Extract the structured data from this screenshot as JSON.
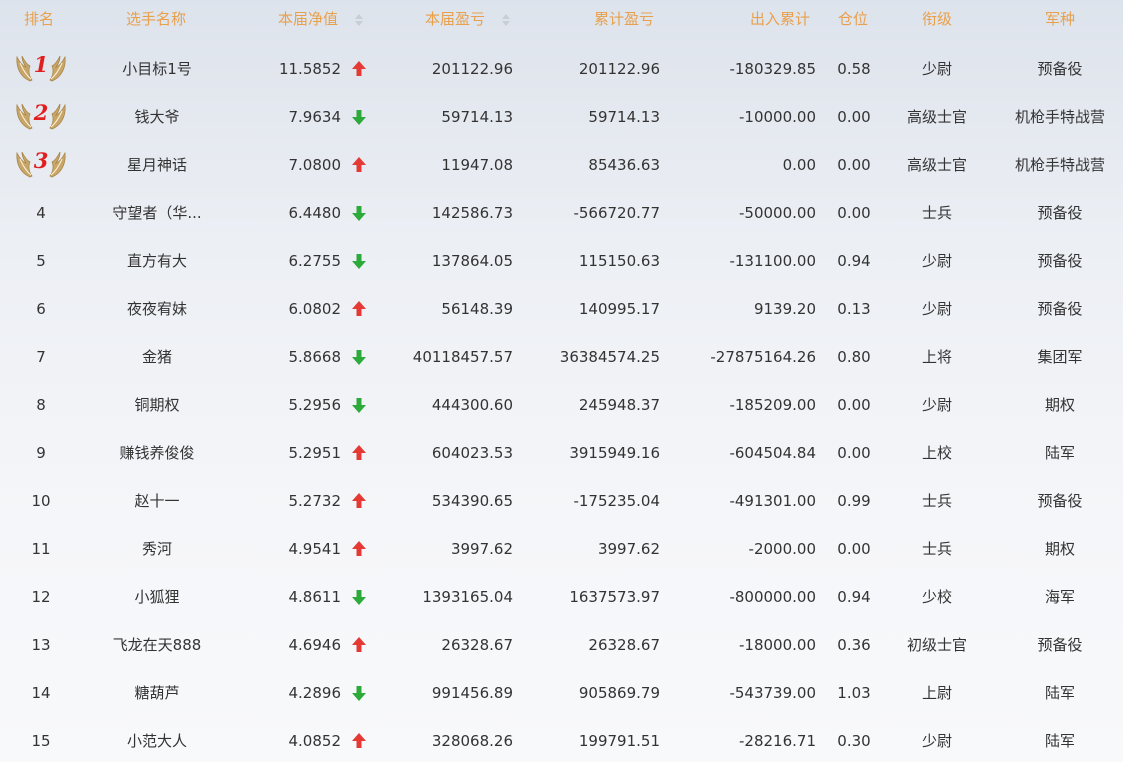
{
  "columns": {
    "rank": "排名",
    "name": "选手名称",
    "nav": "本届净值",
    "pnl": "本届盈亏",
    "cum_pnl": "累计盈亏",
    "flow": "出入累计",
    "position": "仓位",
    "title": "衔级",
    "army": "军种"
  },
  "colors": {
    "header_text": "#e8a04c",
    "arrow_up": "#e53935",
    "arrow_down": "#2eaa3a",
    "medal_number": "#e02020",
    "wing": "#c8a66a"
  },
  "rows": [
    {
      "rank": "1",
      "name": "小目标1号",
      "nav": "11.5852",
      "trend": "up",
      "pnl": "201122.96",
      "cum_pnl": "201122.96",
      "flow": "-180329.85",
      "position": "0.58",
      "title": "少尉",
      "army": "预备役"
    },
    {
      "rank": "2",
      "name": "钱大爷",
      "nav": "7.9634",
      "trend": "down",
      "pnl": "59714.13",
      "cum_pnl": "59714.13",
      "flow": "-10000.00",
      "position": "0.00",
      "title": "高级士官",
      "army": "机枪手特战营"
    },
    {
      "rank": "3",
      "name": "星月神话",
      "nav": "7.0800",
      "trend": "up",
      "pnl": "11947.08",
      "cum_pnl": "85436.63",
      "flow": "0.00",
      "position": "0.00",
      "title": "高级士官",
      "army": "机枪手特战营"
    },
    {
      "rank": "4",
      "name": "守望者（华...",
      "nav": "6.4480",
      "trend": "down",
      "pnl": "142586.73",
      "cum_pnl": "-566720.77",
      "flow": "-50000.00",
      "position": "0.00",
      "title": "士兵",
      "army": "预备役"
    },
    {
      "rank": "5",
      "name": "直方有大",
      "nav": "6.2755",
      "trend": "down",
      "pnl": "137864.05",
      "cum_pnl": "115150.63",
      "flow": "-131100.00",
      "position": "0.94",
      "title": "少尉",
      "army": "预备役"
    },
    {
      "rank": "6",
      "name": "夜夜宥妹",
      "nav": "6.0802",
      "trend": "up",
      "pnl": "56148.39",
      "cum_pnl": "140995.17",
      "flow": "9139.20",
      "position": "0.13",
      "title": "少尉",
      "army": "预备役"
    },
    {
      "rank": "7",
      "name": "金猪",
      "nav": "5.8668",
      "trend": "down",
      "pnl": "40118457.57",
      "cum_pnl": "36384574.25",
      "flow": "-27875164.26",
      "position": "0.80",
      "title": "上将",
      "army": "集团军"
    },
    {
      "rank": "8",
      "name": "铜期权",
      "nav": "5.2956",
      "trend": "down",
      "pnl": "444300.60",
      "cum_pnl": "245948.37",
      "flow": "-185209.00",
      "position": "0.00",
      "title": "少尉",
      "army": "期权"
    },
    {
      "rank": "9",
      "name": "赚钱养俊俊",
      "nav": "5.2951",
      "trend": "up",
      "pnl": "604023.53",
      "cum_pnl": "3915949.16",
      "flow": "-604504.84",
      "position": "0.00",
      "title": "上校",
      "army": "陆军"
    },
    {
      "rank": "10",
      "name": "赵十一",
      "nav": "5.2732",
      "trend": "up",
      "pnl": "534390.65",
      "cum_pnl": "-175235.04",
      "flow": "-491301.00",
      "position": "0.99",
      "title": "士兵",
      "army": "预备役"
    },
    {
      "rank": "11",
      "name": "秀河",
      "nav": "4.9541",
      "trend": "up",
      "pnl": "3997.62",
      "cum_pnl": "3997.62",
      "flow": "-2000.00",
      "position": "0.00",
      "title": "士兵",
      "army": "期权"
    },
    {
      "rank": "12",
      "name": "小狐狸",
      "nav": "4.8611",
      "trend": "down",
      "pnl": "1393165.04",
      "cum_pnl": "1637573.97",
      "flow": "-800000.00",
      "position": "0.94",
      "title": "少校",
      "army": "海军"
    },
    {
      "rank": "13",
      "name": "飞龙在天888",
      "nav": "4.6946",
      "trend": "up",
      "pnl": "26328.67",
      "cum_pnl": "26328.67",
      "flow": "-18000.00",
      "position": "0.36",
      "title": "初级士官",
      "army": "预备役"
    },
    {
      "rank": "14",
      "name": "糖葫芦",
      "nav": "4.2896",
      "trend": "down",
      "pnl": "991456.89",
      "cum_pnl": "905869.79",
      "flow": "-543739.00",
      "position": "1.03",
      "title": "上尉",
      "army": "陆军"
    },
    {
      "rank": "15",
      "name": "小范大人",
      "nav": "4.0852",
      "trend": "up",
      "pnl": "328068.26",
      "cum_pnl": "199791.51",
      "flow": "-28216.71",
      "position": "0.30",
      "title": "少尉",
      "army": "陆军"
    }
  ]
}
